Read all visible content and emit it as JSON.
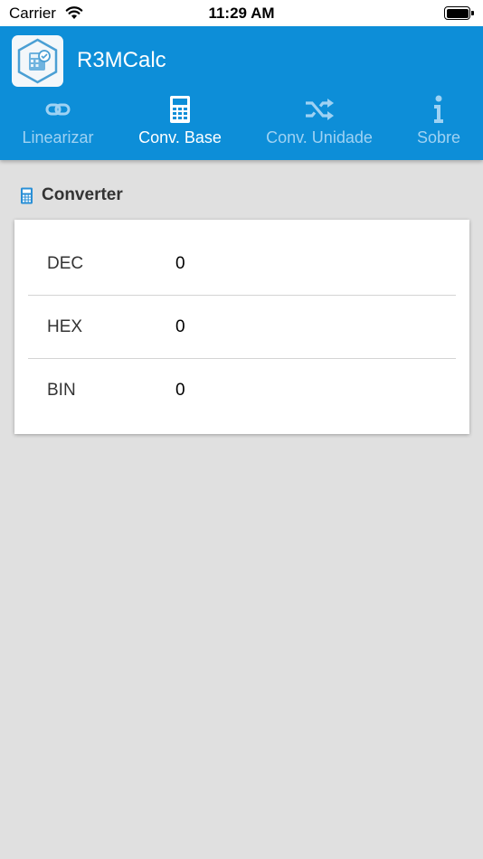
{
  "status_bar": {
    "carrier": "Carrier",
    "time": "11:29 AM"
  },
  "header": {
    "app_title": "R3MCalc",
    "accent_color": "#0d8ed8"
  },
  "tabs": [
    {
      "label": "Linearizar",
      "icon": "link-icon",
      "active": false
    },
    {
      "label": "Conv. Base",
      "icon": "calculator-icon",
      "active": true
    },
    {
      "label": "Conv. Unidade",
      "icon": "shuffle-icon",
      "active": false
    },
    {
      "label": "Sobre",
      "icon": "info-icon",
      "active": false
    }
  ],
  "section": {
    "title": "Converter",
    "icon": "calculator-icon"
  },
  "converter": {
    "rows": [
      {
        "label": "DEC",
        "value": "0"
      },
      {
        "label": "HEX",
        "value": "0"
      },
      {
        "label": "BIN",
        "value": "0"
      }
    ]
  }
}
